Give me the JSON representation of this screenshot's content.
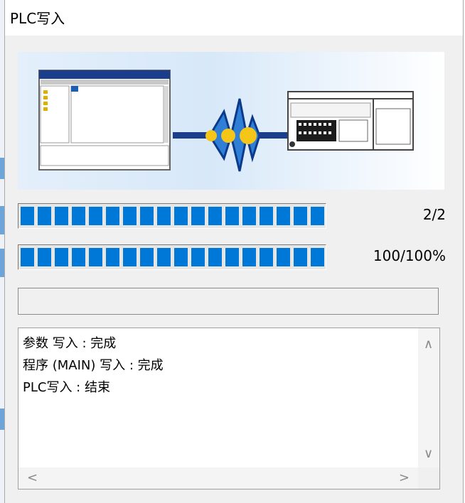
{
  "window": {
    "title": "PLC写入"
  },
  "progress": [
    {
      "label": "2/2",
      "fraction": 1.0,
      "segments": 18
    },
    {
      "label": "100/100%",
      "fraction": 1.0,
      "segments": 18
    }
  ],
  "status_text": "",
  "log": {
    "lines": [
      "参数 写入 : 完成",
      "程序 (MAIN) 写入 : 完成",
      "PLC写入 : 结束"
    ]
  },
  "colors": {
    "progress_fill": "#0078d7",
    "dialog_bg": "#f0f0f0"
  },
  "icons": {
    "scroll_up": "∧",
    "scroll_down": "∨",
    "scroll_left": "<",
    "scroll_right": ">"
  }
}
